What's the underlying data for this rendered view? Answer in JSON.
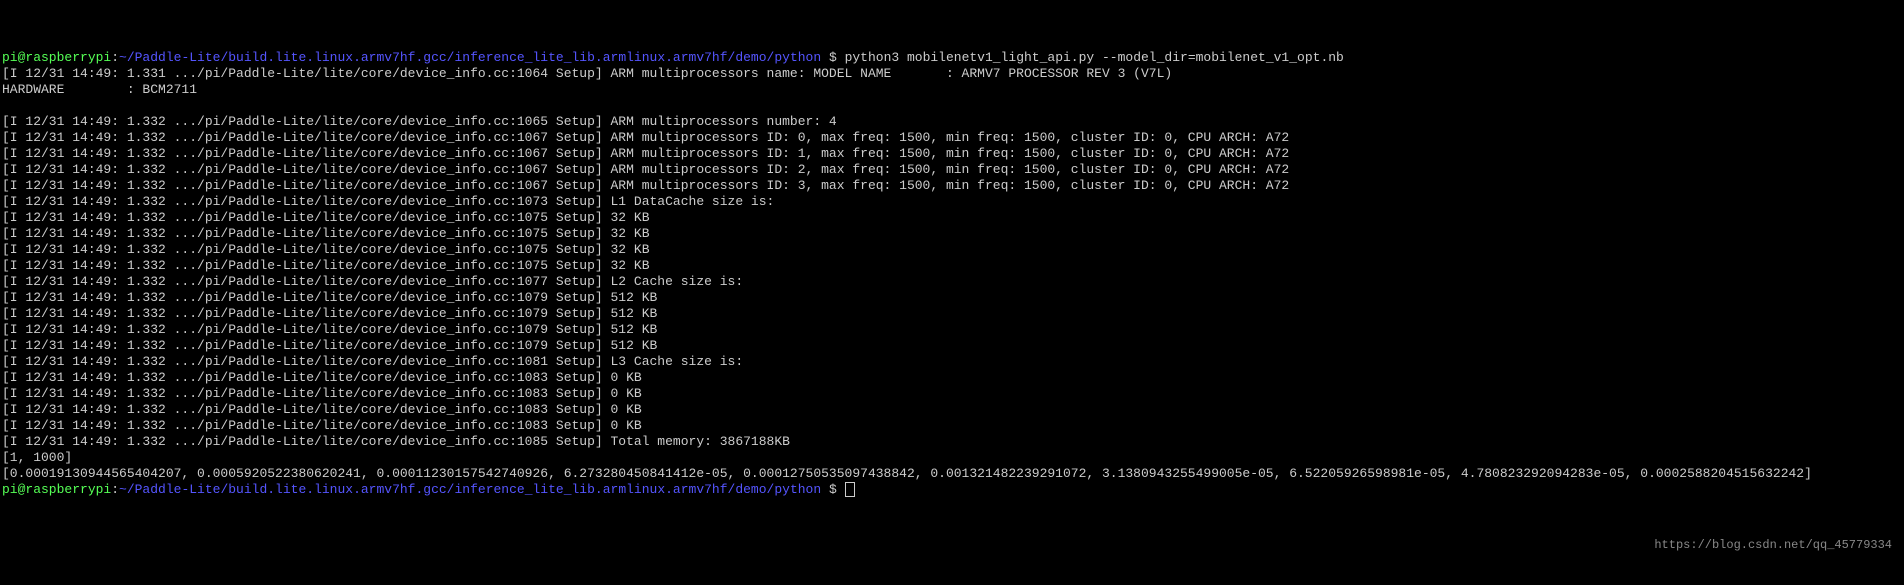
{
  "prompt1": {
    "user": "pi@raspberrypi",
    "sep1": ":",
    "path": "~/Paddle-Lite/build.lite.linux.armv7hf.gcc/inference_lite_lib.armlinux.armv7hf/demo/python",
    "sep2": " $ ",
    "cmd": "python3 mobilenetv1_light_api.py --model_dir=mobilenet_v1_opt.nb"
  },
  "line_setup1064": "[I 12/31 14:49: 1.331 .../pi/Paddle-Lite/lite/core/device_info.cc:1064 Setup] ARM multiprocessors name: MODEL NAME       : ARMV7 PROCESSOR REV 3 (V7L)",
  "line_hardware": "HARDWARE        : BCM2711",
  "blank": "",
  "log_prefix": "[I 12/31 14:49: 1.332 .../pi/Paddle-Lite/lite/core/device_info.cc:",
  "lines": [
    {
      "cc": "1065",
      "msg": "ARM multiprocessors number: 4"
    },
    {
      "cc": "1067",
      "msg": "ARM multiprocessors ID: 0, max freq: 1500, min freq: 1500, cluster ID: 0, CPU ARCH: A72"
    },
    {
      "cc": "1067",
      "msg": "ARM multiprocessors ID: 1, max freq: 1500, min freq: 1500, cluster ID: 0, CPU ARCH: A72"
    },
    {
      "cc": "1067",
      "msg": "ARM multiprocessors ID: 2, max freq: 1500, min freq: 1500, cluster ID: 0, CPU ARCH: A72"
    },
    {
      "cc": "1067",
      "msg": "ARM multiprocessors ID: 3, max freq: 1500, min freq: 1500, cluster ID: 0, CPU ARCH: A72"
    },
    {
      "cc": "1073",
      "msg": "L1 DataCache size is:"
    },
    {
      "cc": "1075",
      "msg": "32 KB"
    },
    {
      "cc": "1075",
      "msg": "32 KB"
    },
    {
      "cc": "1075",
      "msg": "32 KB"
    },
    {
      "cc": "1075",
      "msg": "32 KB"
    },
    {
      "cc": "1077",
      "msg": "L2 Cache size is:"
    },
    {
      "cc": "1079",
      "msg": "512 KB"
    },
    {
      "cc": "1079",
      "msg": "512 KB"
    },
    {
      "cc": "1079",
      "msg": "512 KB"
    },
    {
      "cc": "1079",
      "msg": "512 KB"
    },
    {
      "cc": "1081",
      "msg": "L3 Cache size is:"
    },
    {
      "cc": "1083",
      "msg": "0 KB"
    },
    {
      "cc": "1083",
      "msg": "0 KB"
    },
    {
      "cc": "1083",
      "msg": "0 KB"
    },
    {
      "cc": "1083",
      "msg": "0 KB"
    },
    {
      "cc": "1085",
      "msg": "Total memory: 3867188KB"
    }
  ],
  "output_shape": "[1, 1000]",
  "output_values": "[0.00019130944565404207, 0.0005920522380620241, 0.00011230157542740926, 6.273280450841412e-05, 0.00012750535097438842, 0.001321482239291072, 3.1380943255499005e-05, 6.52205926598981e-05, 4.780823292094283e-05, 0.0002588204515632242]",
  "prompt2": {
    "user": "pi@raspberrypi",
    "sep1": ":",
    "path": "~/Paddle-Lite/build.lite.linux.armv7hf.gcc/inference_lite_lib.armlinux.armv7hf/demo/python",
    "sep2": " $ "
  },
  "watermark": "https://blog.csdn.net/qq_45779334"
}
